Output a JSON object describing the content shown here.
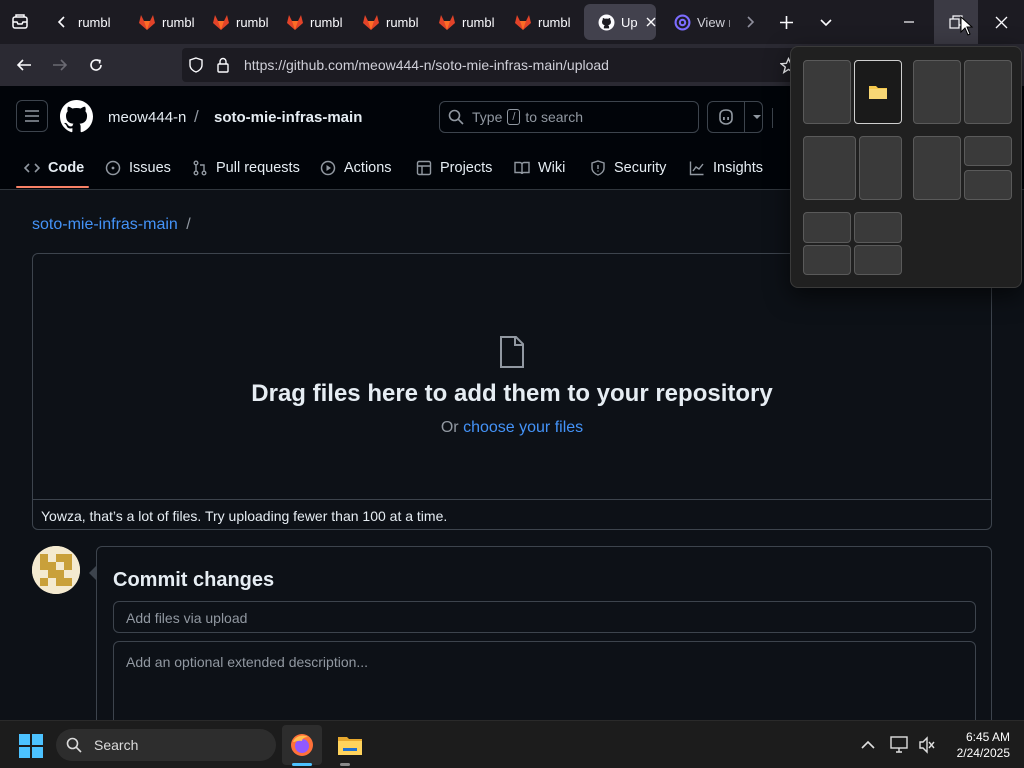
{
  "browser": {
    "tabs": [
      {
        "label": "rumbl",
        "icon": "gitlab-icon"
      },
      {
        "label": "rumbl",
        "icon": "gitlab-icon"
      },
      {
        "label": "rumbl",
        "icon": "gitlab-icon"
      },
      {
        "label": "rumbl",
        "icon": "gitlab-icon"
      },
      {
        "label": "rumbl",
        "icon": "gitlab-icon"
      },
      {
        "label": "rumbl",
        "icon": "gitlab-icon"
      },
      {
        "label": "rumbl",
        "icon": "gitlab-icon"
      },
      {
        "label": "Upl",
        "icon": "github-icon",
        "active": true
      },
      {
        "label": "View r",
        "icon": "proton-icon"
      }
    ],
    "url": "https://github.com/meow444-n/soto-mie-infras-main/upload",
    "url_host": "github.com"
  },
  "github": {
    "owner": "meow444-n",
    "separator": "/",
    "repo": "soto-mie-infras-main",
    "search_placeholder_pre": "Type",
    "search_key": "/",
    "search_placeholder_post": "to search",
    "nav": [
      {
        "label": "Code",
        "icon": "code-icon",
        "active": true
      },
      {
        "label": "Issues",
        "icon": "issue-icon"
      },
      {
        "label": "Pull requests",
        "icon": "pull-request-icon"
      },
      {
        "label": "Actions",
        "icon": "play-icon"
      },
      {
        "label": "Projects",
        "icon": "table-icon"
      },
      {
        "label": "Wiki",
        "icon": "book-icon"
      },
      {
        "label": "Security",
        "icon": "shield-icon"
      },
      {
        "label": "Insights",
        "icon": "graph-icon"
      }
    ]
  },
  "upload": {
    "breadcrumb_repo": "soto-mie-infras-main",
    "breadcrumb_sep": "/",
    "drop_title": "Drag files here to add them to your repository",
    "drop_or": "Or",
    "choose_link": "choose your files",
    "warning": "Yowza, that’s a lot of files. Try uploading fewer than 100 at a time."
  },
  "commit": {
    "title": "Commit changes",
    "summary_placeholder": "Add files via upload",
    "description_placeholder": "Add an optional extended description..."
  },
  "taskbar": {
    "search_label": "Search",
    "time": "6:45 AM",
    "date": "2/24/2025"
  },
  "colors": {
    "link": "#4493f8",
    "accent_underline": "#f78166",
    "gitlab": "#e24329"
  }
}
